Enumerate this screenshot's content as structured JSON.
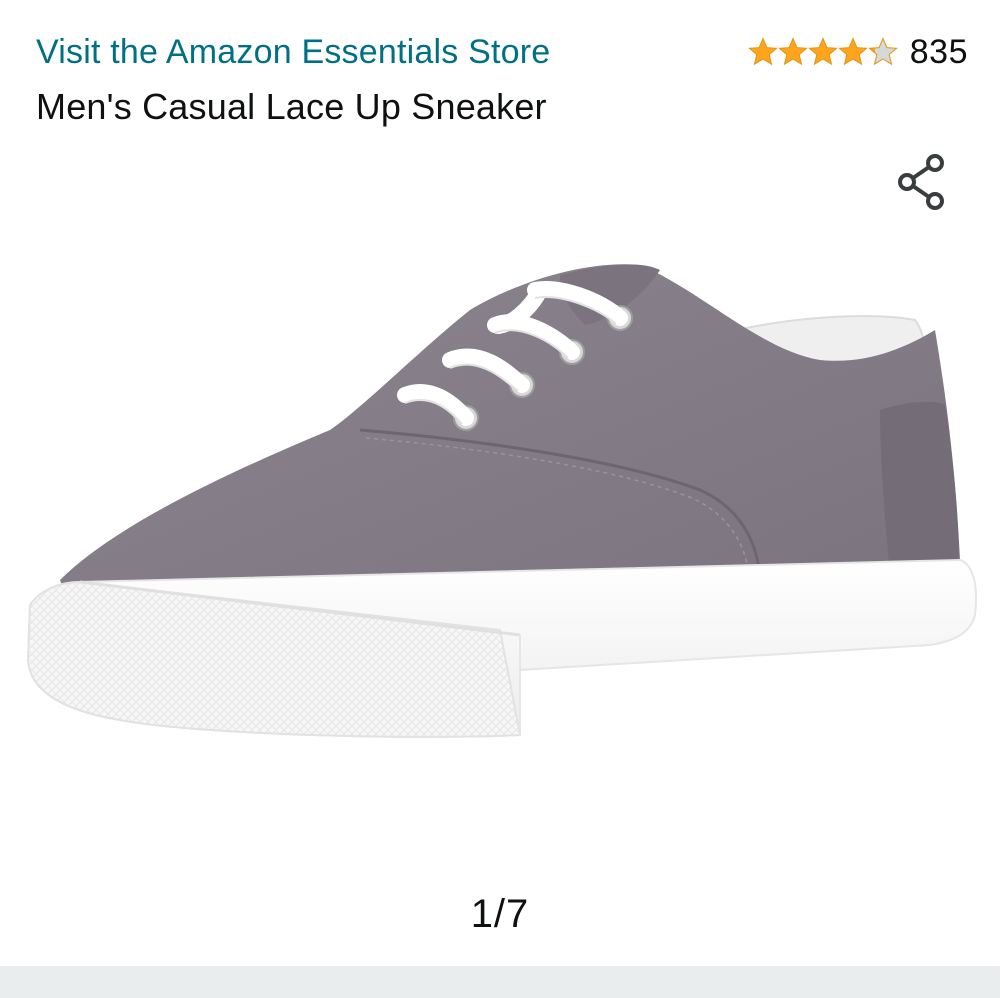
{
  "store": {
    "link_text": "Visit the Amazon Essentials Store"
  },
  "rating": {
    "stars_value": 4.2,
    "stars_max": 5,
    "review_count": "835",
    "star_color": "#ffa41c",
    "star_empty_color": "#d5d9d9"
  },
  "product": {
    "title": "Men's Casual Lace Up Sneaker",
    "image_description": "gray-canvas-sneaker-image"
  },
  "share": {
    "icon": "share-icon"
  },
  "gallery": {
    "pager_text": "1/7",
    "current": 1,
    "total": 7
  },
  "colors": {
    "link": "#007185",
    "text": "#0f1111",
    "divider": "#eaeded"
  }
}
